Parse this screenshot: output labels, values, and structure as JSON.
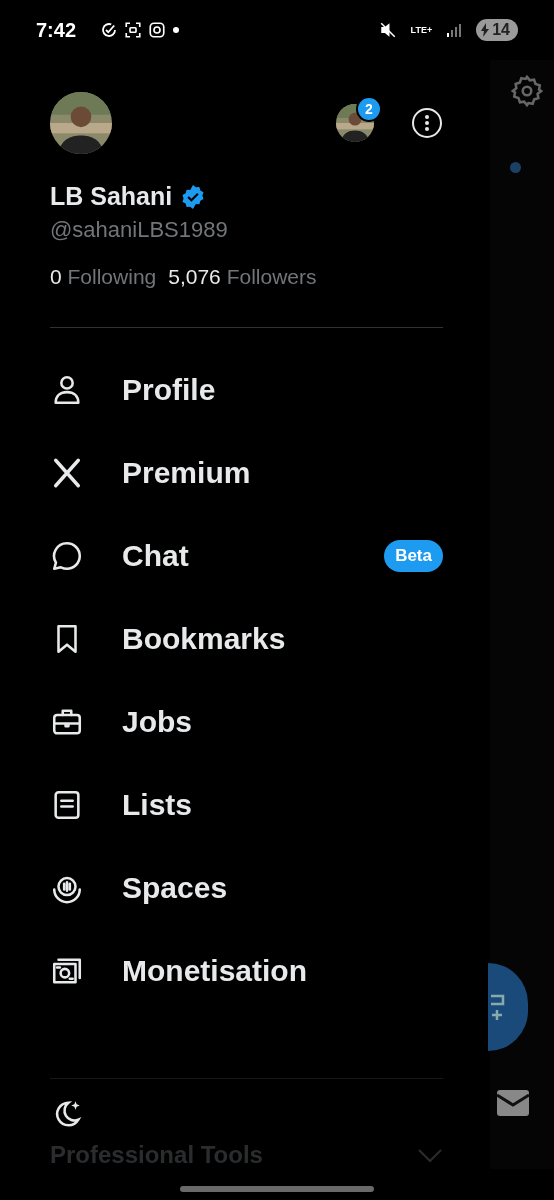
{
  "status_bar": {
    "time": "7:42",
    "network": "LTE+",
    "battery": "14"
  },
  "account": {
    "name": "LB Sahani",
    "verified": true,
    "handle": "@sahaniLBS1989",
    "following_count": "0",
    "following_label": "Following",
    "followers_count": "5,076",
    "followers_label": "Followers",
    "other_accounts_badge": "2"
  },
  "menu": [
    {
      "kind": "profile",
      "label": "Profile"
    },
    {
      "kind": "premium",
      "label": "Premium"
    },
    {
      "kind": "chat",
      "label": "Chat",
      "badge": "Beta"
    },
    {
      "kind": "bookmarks",
      "label": "Bookmarks"
    },
    {
      "kind": "jobs",
      "label": "Jobs"
    },
    {
      "kind": "lists",
      "label": "Lists"
    },
    {
      "kind": "spaces",
      "label": "Spaces"
    },
    {
      "kind": "monetisation",
      "label": "Monetisation"
    }
  ],
  "footer": {
    "section_label": "Professional Tools",
    "expanded": false
  }
}
